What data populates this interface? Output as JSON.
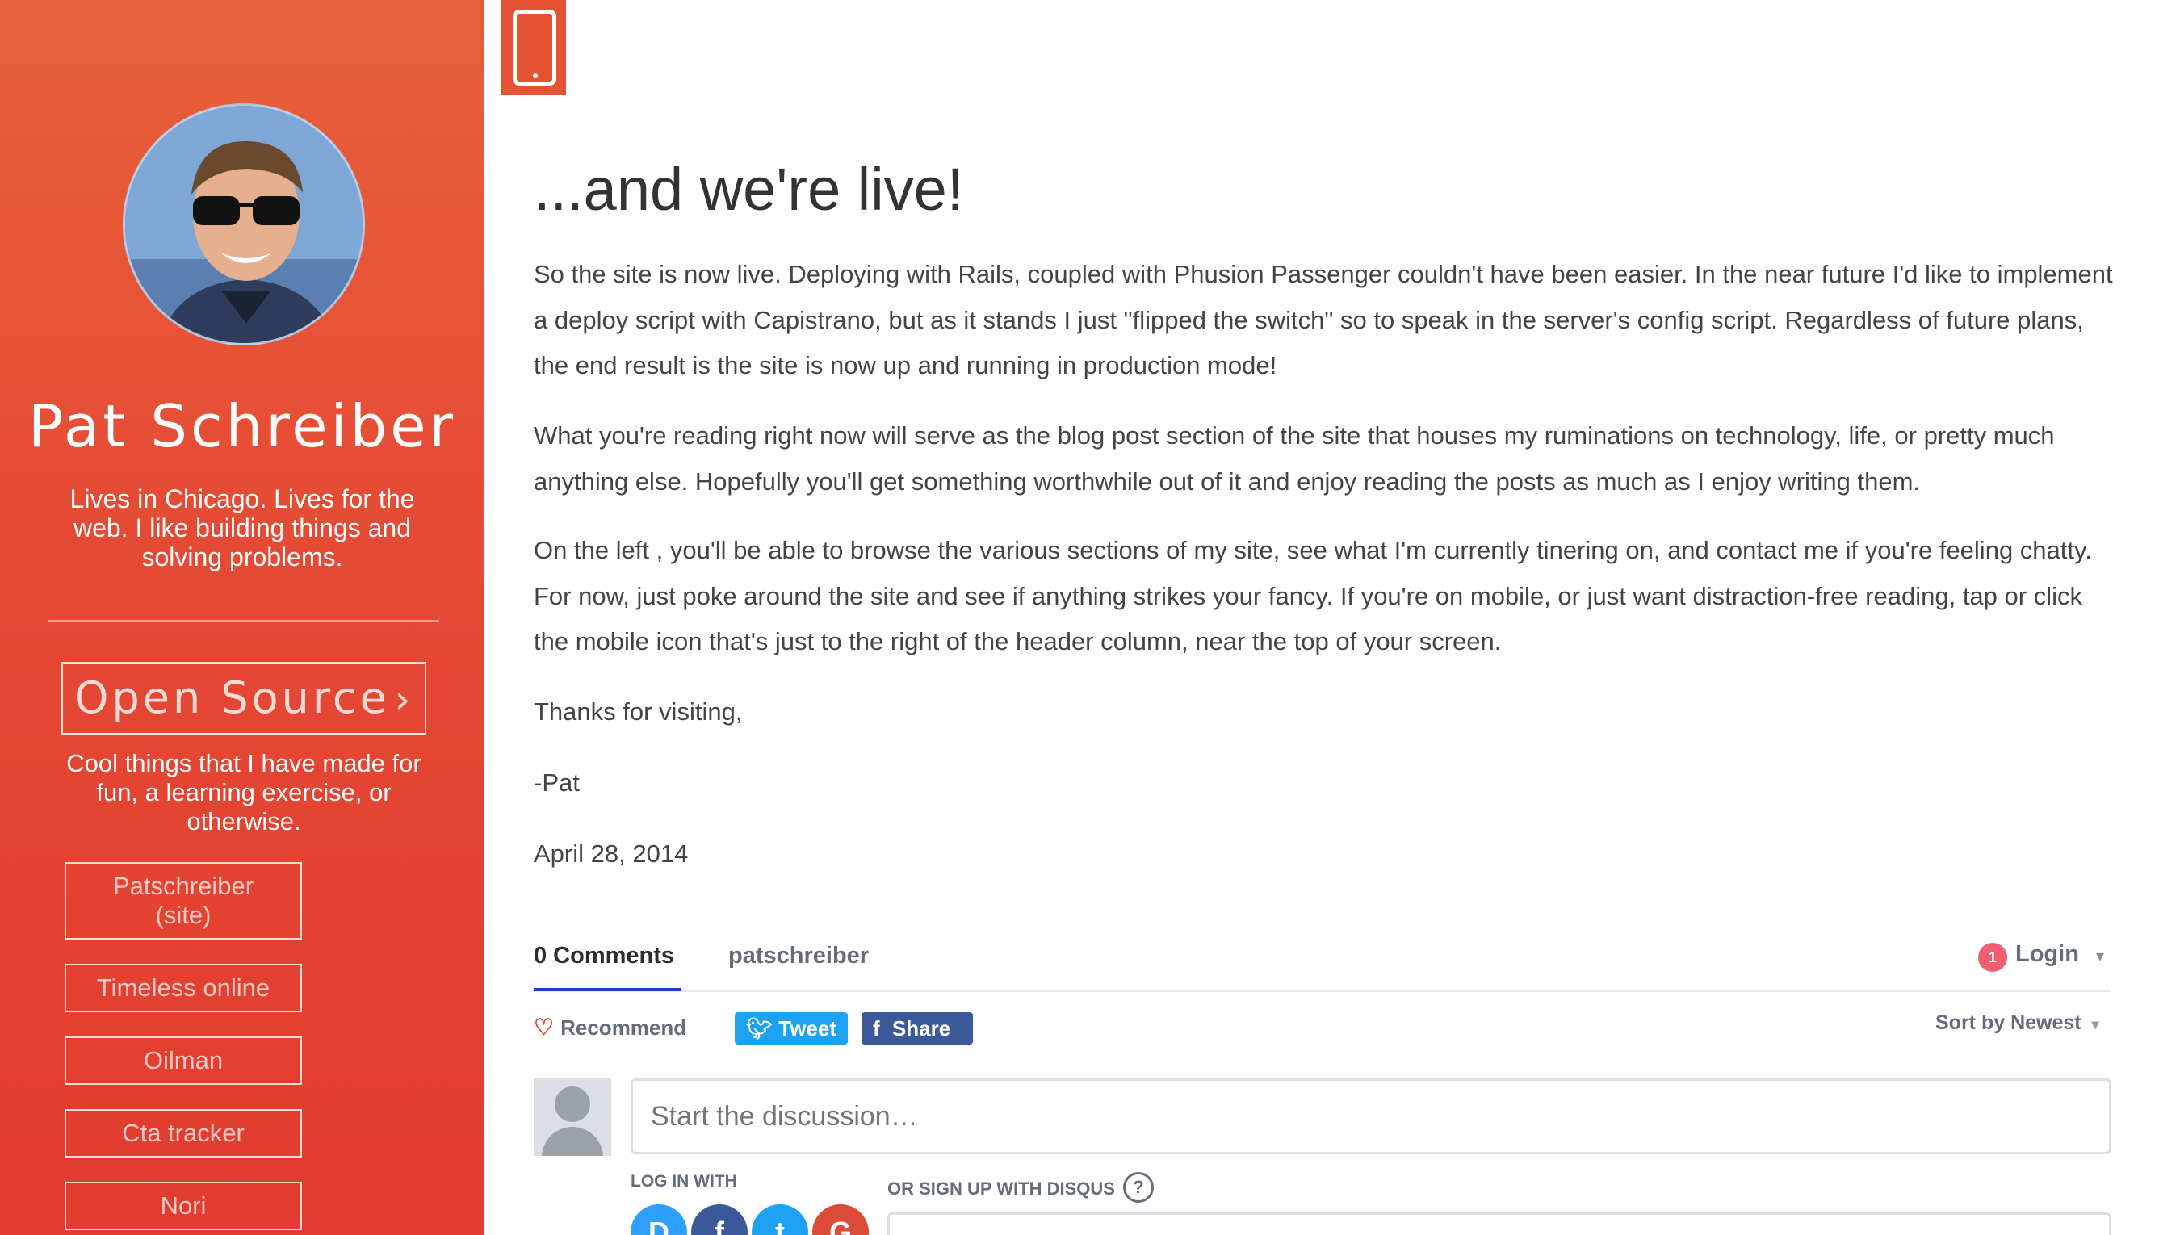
{
  "sidebar": {
    "name": "Pat Schreiber",
    "bio": "Lives in Chicago. Lives for the web. I like building things and solving problems.",
    "open_source": {
      "label": "Open Source",
      "chevron": "›",
      "description": "Cool things that I have made for fun, a learning exercise, or otherwise."
    },
    "projects": [
      {
        "label": "Patschreiber (site)"
      },
      {
        "label": "Timeless online"
      },
      {
        "label": "Oilman"
      },
      {
        "label": "Cta tracker"
      },
      {
        "label": "Nori"
      }
    ]
  },
  "mobile_toggle": {
    "icon": "mobile-phone-icon",
    "color": "#e65332"
  },
  "post": {
    "title": "...and we're live!",
    "paragraphs": [
      "So the site is now live. Deploying with Rails, coupled with Phusion Passenger couldn't have been easier. In the near future I'd like to implement a deploy script with Capistrano, but as it stands I just \"flipped the switch\" so to speak in the server's config script. Regardless of future plans, the end result is the site is now up and running in production mode!",
      "What you're reading right now will serve as the blog post section of the site that houses my ruminations on technology, life, or pretty much anything else. Hopefully you'll get something worthwhile out of it and enjoy reading the posts as much as I enjoy writing them.",
      "On the left , you'll be able to browse the various sections of my site, see what I'm currently tinering on, and contact me if you're feeling chatty. For now, just poke around the site and see if anything strikes your fancy. If you're on mobile, or just want distraction-free reading, tap or click the mobile icon that's just to the right of the header column, near the top of your screen.",
      "Thanks for visiting,",
      "-Pat"
    ],
    "date": "April 28, 2014"
  },
  "disqus": {
    "comment_count": "0 Comments",
    "forum": "patschreiber",
    "login_label": "Login",
    "notification_count": "1",
    "recommend_label": "Recommend",
    "tweet_label": "Tweet",
    "share_label": "Share",
    "sort_label": "Sort by Newest",
    "input_placeholder": "Start the discussion…",
    "login_with_label": "LOG IN WITH",
    "signup_label": "OR SIGN UP WITH DISQUS",
    "help_icon_label": "?",
    "social_logins": [
      {
        "icon": "disqus-icon",
        "glyph": "D",
        "color": "#2e9fff"
      },
      {
        "icon": "facebook-icon",
        "glyph": "f",
        "color": "#3b5998"
      },
      {
        "icon": "twitter-icon",
        "glyph": "t",
        "color": "#1da1f2"
      },
      {
        "icon": "google-icon",
        "glyph": "G",
        "color": "#dd4b39"
      }
    ]
  },
  "colors": {
    "sidebar_top": "#e8603a",
    "sidebar_bottom": "#e23b2f",
    "accent": "#e65332"
  }
}
